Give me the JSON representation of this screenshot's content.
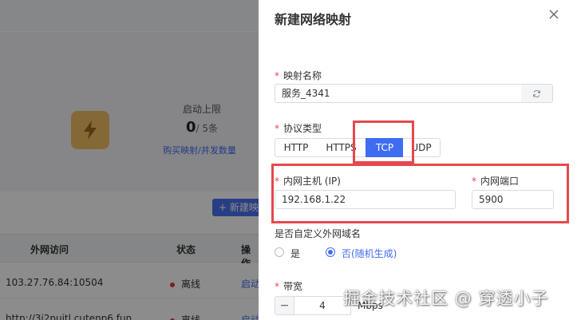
{
  "background": {
    "quota_label": "启动上限",
    "quota_value": "0",
    "quota_total": "/ 5条",
    "buy_link": "购买映射/并发数量",
    "new_button": "+ 新建映",
    "table": {
      "headers": [
        "外网访问",
        "状态",
        "操作"
      ],
      "rows": [
        {
          "address": "103.27.76.84:10504",
          "status": "离线",
          "action": "启动"
        },
        {
          "address": "http://3i2puitl.cutenp6.fun",
          "status": "离线",
          "action": "启动"
        }
      ]
    }
  },
  "drawer": {
    "title": "新建网络映射",
    "mapping_name": {
      "label": "映射名称",
      "value": "服务_4341"
    },
    "protocol": {
      "label": "协议类型",
      "options": [
        "HTTP",
        "HTTPS",
        "TCP",
        "UDP"
      ],
      "selected": "TCP"
    },
    "host": {
      "label": "内网主机 (IP)",
      "value": "192.168.1.22"
    },
    "port": {
      "label": "内网端口",
      "value": "5900"
    },
    "custom_domain": {
      "label": "是否自定义外网域名",
      "options": [
        "是",
        "否(随机生成)"
      ],
      "selected": "否(随机生成)"
    },
    "bandwidth": {
      "label": "带宽",
      "value": "4",
      "unit": "Mbps"
    }
  },
  "watermark": "掘金技术社区 @ 穿透小子",
  "colors": {
    "accent": "#3f6df2",
    "highlight": "#e5484d",
    "required": "#e5484d",
    "offline": "#e53935"
  }
}
